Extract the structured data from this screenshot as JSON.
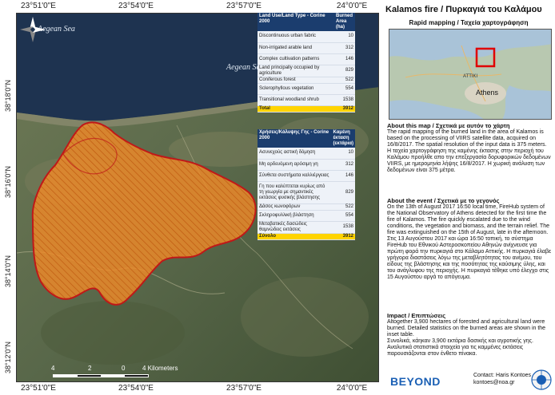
{
  "map": {
    "coords_top": [
      "23°51'0\"E",
      "23°54'0\"E",
      "23°57'0\"E",
      "24°0'0\"E"
    ],
    "coords_bottom": [
      "23°51'0\"E",
      "23°54'0\"E",
      "23°57'0\"E",
      "24°0'0\"E"
    ],
    "coords_left": [
      "38°18'0\"N",
      "38°16'0\"N",
      "38°14'0\"N",
      "38°12'0\"N"
    ],
    "sea_label_1": "Aegean Sea",
    "sea_label_2": "Aegean Sea",
    "scale_labels": [
      "4",
      "2",
      "0",
      "4 Kilometers"
    ],
    "colors": {
      "burned_fill": "#f08a28",
      "burned_outline": "#c01818",
      "table_header": "#1b3d6e",
      "total_row": "#ffd400"
    }
  },
  "table_en": {
    "header": [
      "Land Use/Land Type - Corine 2000",
      "Burned Area (ha)"
    ],
    "rows": [
      [
        "Discontinuous urban fabric",
        "10"
      ],
      [
        "Non-irrigated arable land",
        "312"
      ],
      [
        "Complex cultivation patterns",
        "146"
      ],
      [
        "Land principally occupied by agriculture",
        "829"
      ],
      [
        "Coniferous forest",
        "522"
      ],
      [
        "Sclerophyllous vegetation",
        "554"
      ],
      [
        "Transitional woodland shrub",
        "1538"
      ]
    ],
    "total": [
      "Total",
      "3912"
    ]
  },
  "table_gr": {
    "header": [
      "Χρήσεις/Κάλυψης Γης - Corine 2000",
      "Καμένη έκταση (εκτάρια)"
    ],
    "rows": [
      [
        "Ασυνεχούς αστική δόμηση",
        "10"
      ],
      [
        "Μη αρδευόμενη αρόσιμη γη",
        "312"
      ],
      [
        "Σύνθετα συστήματα καλλιέργειας",
        "146"
      ],
      [
        "Γη που καλύπτεται κυρίως από τη γεωργία με σημαντικές εκτάσεις φυσικής βλάστησης",
        "829"
      ],
      [
        "Δάσος κωνοφόρων",
        "522"
      ],
      [
        "Σκληροφυλλική βλάστηση",
        "554"
      ],
      [
        "Μεταβατικές δασώδεις θαμνώδεις εκτάσεις",
        "1538"
      ]
    ],
    "total": [
      "Σύνολο",
      "3912"
    ]
  },
  "panel": {
    "title": "Kalamos fire / Πυρκαγιά του Καλάμου",
    "subtitle": "Rapid mapping / Ταχεία χαρτογράφηση",
    "inset_label_1": "ATTIKI",
    "inset_label_2": "Athens",
    "about_map_heading": "About this map / Σχετικά με αυτόν το χάρτη",
    "about_map_en": "The rapid mapping of the burned land in the area of Kalamos is based on the processing of VIIRS satellite data, acquired on 16/8/2017. The spatial resolution of the input data is 375 meters.",
    "about_map_gr": "Η ταχεία χαρτογράφηση της καμένης έκτασης στην περιοχή του Καλάμου προήλθε απο την επεξεργασία δορυφορικών δεδομένων VIIRS, με ημερομηνία λήψης 16/8/2017. Η χωρική ανάλυση των δεδομένων είναι 375 μέτρα.",
    "about_event_heading": "About the event / Σχετικά με το γεγονός",
    "about_event_en": "On the 13th of August 2017 16:50 local time, FireHub system of the National Observatory of Athens detected for the first time the fire of Kalamos. The fire quickly escalated due to the wind conditions, the vegetation and biomass, and the terrain relief. The fire was extinguished on the 15th of August, late in the afternoon.",
    "about_event_gr": "Στις 13 Αυγούστου 2017 και ώρα 16:50 τοπική, το σύστημα FireHub του Εθνικού Αστεροσκοπείου Αθηνών ανίχνευσε για πρώτη φορά την πυρκαγιά στο Κάλαμο Αττικής. Η πυρκαγιά έλαβε γρήγορα διαστάσεις λόγω της μεταβλητότητας του ανέμου, του είδους της βλάστησης και της ποσότητας της καύσιμης ύλης, και του ανάγλυφου της περιοχής. Η πυρκαγιά τέθηκε υπό έλεγχο στις 15 Αυγούστου αργά το απόγευμα.",
    "impact_heading": "Impact / Επιπτώσεις",
    "impact_en": "Altogether 3,900 hectares of forested and agricultural land were burned. Detailed statistics on the burned areas are shown in the inset table.",
    "impact_gr": "Συνολικά, κάηκαν 3,900 εκτάρια δασικής και αγροτικής γης. Αναλυτικά στατιστικά στοιχεία για τις καμμένες εκτάσεις παρουσιάζονται στον ένθετο πίνακα.",
    "logo": "BEYOND",
    "contact_line_1": "Contact: Haris Kontoes",
    "contact_line_2": "kontoes@noa.gr"
  }
}
